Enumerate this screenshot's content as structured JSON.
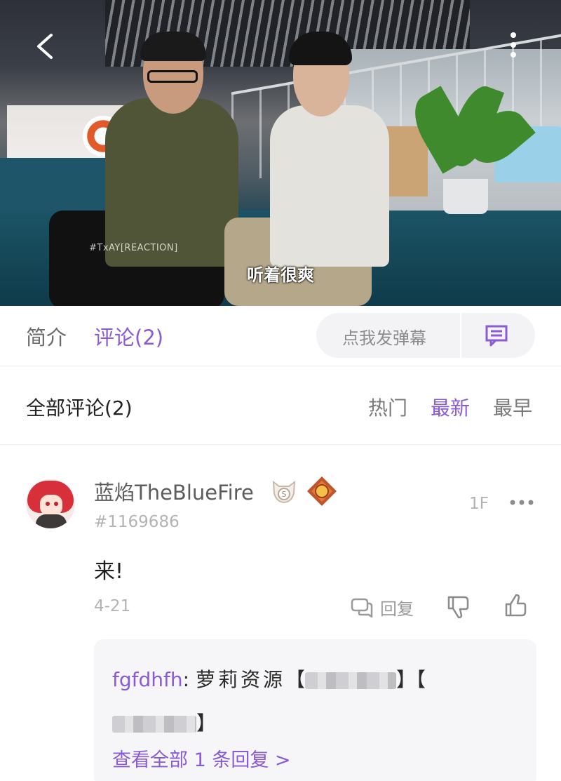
{
  "video": {
    "tag": "#TxAY[REACTION]",
    "subtitle": "听着很爽"
  },
  "tabs": {
    "intro": "简介",
    "comments": "评论(2)",
    "danmaku_placeholder": "点我发弹幕"
  },
  "filter": {
    "all_comments": "全部评论(2)",
    "hot": "热门",
    "newest": "最新",
    "oldest": "最早",
    "active": "最新"
  },
  "comment": {
    "username": "蓝焰TheBlueFire",
    "user_id": "#1169686",
    "floor": "1F",
    "text": "来!",
    "date": "4-21",
    "reply_label": "回复",
    "reply_preview": {
      "user": "fgfdhfh",
      "separator": ":",
      "content": "萝莉资源",
      "bracket_open": "【",
      "bracket_close": "】",
      "view_all": "查看全部 1 条回复 >"
    }
  },
  "colors": {
    "accent": "#8a5bd6",
    "muted": "#b3b3b3",
    "reply_bg": "#f6f6f8"
  },
  "icons": {
    "back": "chevron-left-icon",
    "menu": "vertical-dots-icon",
    "danmaku": "message-square-icon",
    "more": "horizontal-dots-icon",
    "reply": "chat-bubbles-icon",
    "dislike": "thumb-down-icon",
    "like": "thumb-up-icon"
  }
}
